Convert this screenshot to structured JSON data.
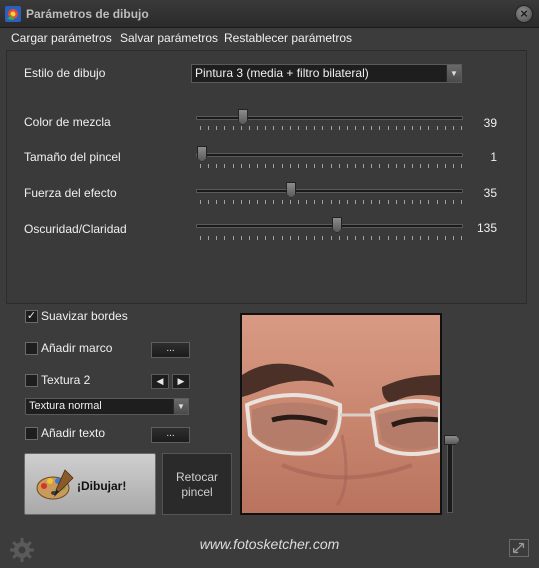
{
  "window": {
    "title": "Parámetros de dibujo",
    "close_glyph": "×"
  },
  "menu": {
    "items": [
      "Cargar parámetros",
      "Salvar parámetros",
      "Restablecer parámetros"
    ]
  },
  "style": {
    "label": "Estilo de dibujo",
    "value": "Pintura 3 (media + filtro bilateral)"
  },
  "sliders": [
    {
      "label": "Color de mezcla",
      "value": "39",
      "fraction": 0.16
    },
    {
      "label": "Tamaño del pincel",
      "value": "1",
      "fraction": 0.0
    },
    {
      "label": "Fuerza del efecto",
      "value": "35",
      "fraction": 0.35
    },
    {
      "label": "Oscuridad/Claridad",
      "value": "135",
      "fraction": 0.53
    }
  ],
  "options": {
    "smooth_edges": {
      "label": "Suavizar bordes",
      "checked": true,
      "mark": "✓"
    },
    "add_frame": {
      "label": "Añadir marco",
      "checked": false,
      "button": "..."
    },
    "texture": {
      "label": "Textura 2",
      "checked": false,
      "prev": "◀",
      "next": "▶",
      "select": "Textura normal"
    },
    "add_text": {
      "label": "Añadir texto",
      "checked": false,
      "button": "..."
    }
  },
  "actions": {
    "draw": "¡Dibujar!",
    "retouch_line1": "Retocar",
    "retouch_line2": "pincel"
  },
  "footer": {
    "url": "www.fotosketcher.com"
  },
  "icons": {
    "app": "app-logo-icon",
    "palette": "palette-icon",
    "gear": "gear-icon",
    "resize": "resize-icon",
    "dropdown": "▼"
  }
}
